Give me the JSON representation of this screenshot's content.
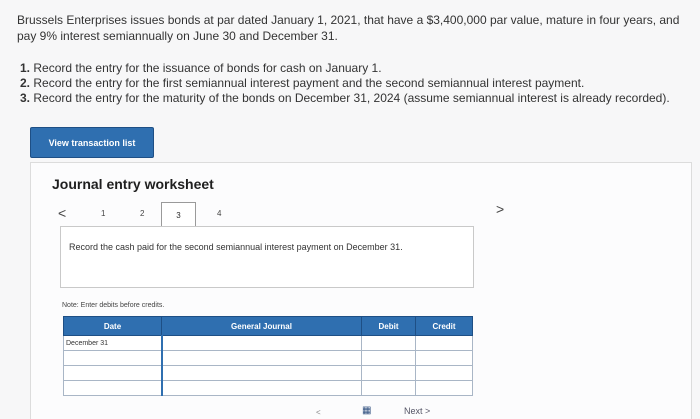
{
  "problem": {
    "statement": "Brussels Enterprises issues bonds at par dated January 1, 2021, that have a $3,400,000 par value, mature in four years, and pay 9% interest semiannually on June 30 and December 31."
  },
  "tasks": [
    {
      "num": "1.",
      "text": "Record the entry for the issuance of bonds for cash on January 1."
    },
    {
      "num": "2.",
      "text": "Record the entry for the first semiannual interest payment and the second semiannual interest payment."
    },
    {
      "num": "3.",
      "text": "Record the entry for the maturity of the bonds on December 31, 2024 (assume semiannual interest is already recorded)."
    }
  ],
  "view_button": "View transaction list",
  "worksheet": {
    "title": "Journal entry worksheet",
    "pages": [
      "1",
      "2",
      "3",
      "4"
    ],
    "active_page": "3",
    "prev_icon": "chevron-left",
    "next_icon": "chevron-right",
    "instruction": "Record the cash paid for the second semiannual interest payment on December 31.",
    "note": "Note: Enter debits before credits.",
    "columns": {
      "date": "Date",
      "journal": "General Journal",
      "debit": "Debit",
      "credit": "Credit"
    },
    "rows": [
      {
        "date": "December 31",
        "account": "",
        "debit": "",
        "credit": ""
      },
      {
        "date": "",
        "account": "",
        "debit": "",
        "credit": ""
      },
      {
        "date": "",
        "account": "",
        "debit": "",
        "credit": ""
      },
      {
        "date": "",
        "account": "",
        "debit": "",
        "credit": ""
      }
    ],
    "next_label": "Next"
  },
  "colors": {
    "accent": "#2f6fb0",
    "header_border": "#1e4f85"
  }
}
